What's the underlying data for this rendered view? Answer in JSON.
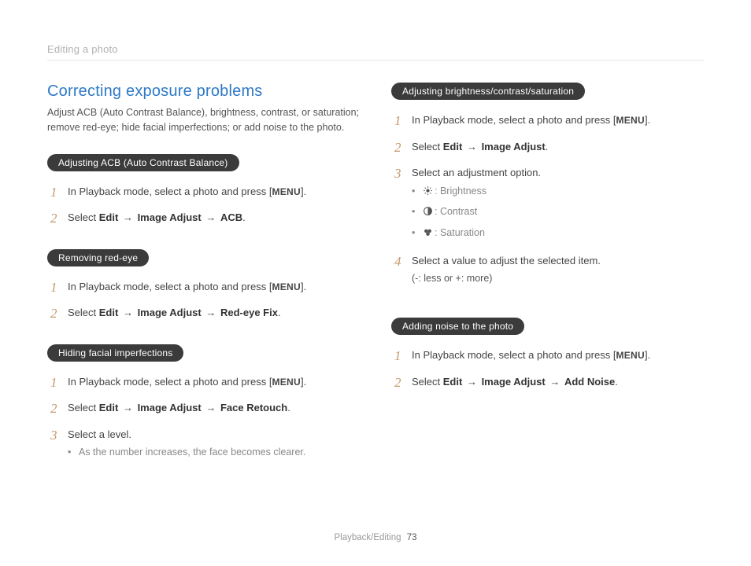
{
  "header": {
    "section": "Editing a photo"
  },
  "title": "Correcting exposure problems",
  "intro": "Adjust ACB (Auto Contrast Balance), brightness, contrast, or saturation; remove red-eye; hide facial imperfections; or add noise to the photo.",
  "menu_key": "MENU",
  "arrow": "→",
  "blocks": {
    "acb": {
      "pill": "Adjusting ACB (Auto Contrast Balance)",
      "step1_pre": "In Playback mode, select a photo and press [",
      "step1_post": "].",
      "step2_select": "Select ",
      "step2_edit": "Edit",
      "step2_ia": "Image Adjust",
      "step2_acb": "ACB",
      "step2_end": "."
    },
    "redeye": {
      "pill": "Removing red-eye",
      "step1_pre": "In Playback mode, select a photo and press [",
      "step1_post": "].",
      "step2_select": "Select ",
      "step2_edit": "Edit",
      "step2_ia": "Image Adjust",
      "step2_fix": "Red-eye Fix",
      "step2_end": "."
    },
    "face": {
      "pill": "Hiding facial imperfections",
      "step1_pre": "In Playback mode, select a photo and press [",
      "step1_post": "].",
      "step2_select": "Select ",
      "step2_edit": "Edit",
      "step2_ia": "Image Adjust",
      "step2_fr": "Face Retouch",
      "step2_end": ".",
      "step3": "Select a level.",
      "step3_note": "As the number increases, the face becomes clearer."
    },
    "bcs": {
      "pill": "Adjusting brightness/contrast/saturation",
      "step1_pre": "In Playback mode, select a photo and press [",
      "step1_post": "].",
      "step2_select": "Select ",
      "step2_edit": "Edit",
      "step2_ia": "Image Adjust",
      "step2_end": ".",
      "step3": "Select an adjustment option.",
      "opt_brightness": ": Brightness",
      "opt_contrast": ": Contrast",
      "opt_saturation": ": Saturation",
      "step4_main": "Select a value to adjust the selected item.",
      "step4_sub": "(-: less or +: more)"
    },
    "noise": {
      "pill": "Adding noise to the photo",
      "step1_pre": "In Playback mode, select a photo and press [",
      "step1_post": "].",
      "step2_select": "Select ",
      "step2_edit": "Edit",
      "step2_ia": "Image Adjust",
      "step2_an": "Add Noise",
      "step2_end": "."
    }
  },
  "footer": {
    "section": "Playback/Editing",
    "page": "73"
  }
}
